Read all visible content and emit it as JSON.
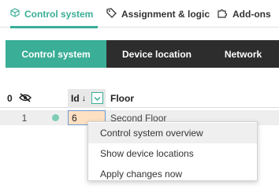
{
  "top_tabs": [
    {
      "label": "Control system",
      "icon": "cube-icon",
      "active": true
    },
    {
      "label": "Assignment & logic",
      "icon": "tag-icon",
      "active": false
    },
    {
      "label": "Add-ons",
      "icon": "puzzle-icon",
      "active": false
    }
  ],
  "sub_tabs": [
    {
      "label": "Control system",
      "active": true
    },
    {
      "label": "Device location",
      "active": false
    },
    {
      "label": "Network",
      "active": false
    }
  ],
  "table": {
    "header": {
      "count": "0",
      "id": "Id",
      "sort": "↓",
      "floor": "Floor"
    },
    "rows": [
      {
        "number": "1",
        "id": "6",
        "floor": "Second Floor"
      }
    ]
  },
  "context_menu": {
    "items": [
      "Control system overview",
      "Show device locations",
      "Apply changes now"
    ]
  },
  "colors": {
    "accent": "#3aae96",
    "dark_bar": "#2d2d2d",
    "edit_cell": "#fde0c2"
  }
}
